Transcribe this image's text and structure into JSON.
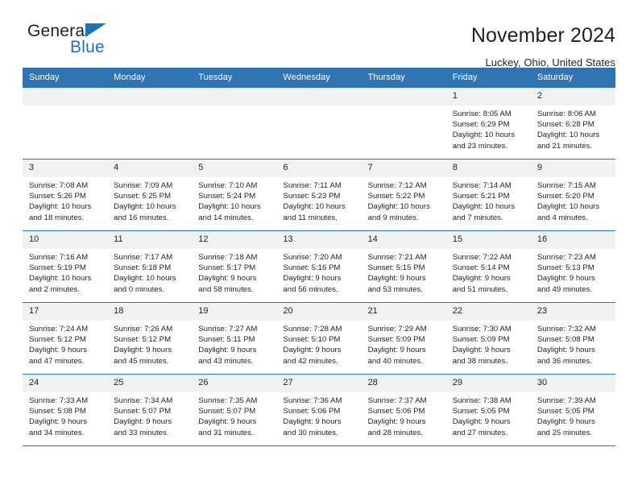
{
  "logo": {
    "word_top": "General",
    "word_bottom": "Blue",
    "triangle_color": "#1b75bc"
  },
  "header": {
    "title": "November 2024",
    "subtitle": "Luckey, Ohio, United States"
  },
  "theme": {
    "header_blue": "#3174b4",
    "daynum_band": "#f1f1f1",
    "text": "#231f20"
  },
  "calendar": {
    "weekday_headers": [
      "Sunday",
      "Monday",
      "Tuesday",
      "Wednesday",
      "Thursday",
      "Friday",
      "Saturday"
    ],
    "weeks": [
      [
        {
          "day": "",
          "empty": true
        },
        {
          "day": "",
          "empty": true
        },
        {
          "day": "",
          "empty": true
        },
        {
          "day": "",
          "empty": true
        },
        {
          "day": "",
          "empty": true
        },
        {
          "day": "1",
          "sunrise": "Sunrise: 8:05 AM",
          "sunset": "Sunset: 6:29 PM",
          "daylight": "Daylight: 10 hours and 23 minutes."
        },
        {
          "day": "2",
          "sunrise": "Sunrise: 8:06 AM",
          "sunset": "Sunset: 6:28 PM",
          "daylight": "Daylight: 10 hours and 21 minutes."
        }
      ],
      [
        {
          "day": "3",
          "sunrise": "Sunrise: 7:08 AM",
          "sunset": "Sunset: 5:26 PM",
          "daylight": "Daylight: 10 hours and 18 minutes."
        },
        {
          "day": "4",
          "sunrise": "Sunrise: 7:09 AM",
          "sunset": "Sunset: 5:25 PM",
          "daylight": "Daylight: 10 hours and 16 minutes."
        },
        {
          "day": "5",
          "sunrise": "Sunrise: 7:10 AM",
          "sunset": "Sunset: 5:24 PM",
          "daylight": "Daylight: 10 hours and 14 minutes."
        },
        {
          "day": "6",
          "sunrise": "Sunrise: 7:11 AM",
          "sunset": "Sunset: 5:23 PM",
          "daylight": "Daylight: 10 hours and 11 minutes."
        },
        {
          "day": "7",
          "sunrise": "Sunrise: 7:12 AM",
          "sunset": "Sunset: 5:22 PM",
          "daylight": "Daylight: 10 hours and 9 minutes."
        },
        {
          "day": "8",
          "sunrise": "Sunrise: 7:14 AM",
          "sunset": "Sunset: 5:21 PM",
          "daylight": "Daylight: 10 hours and 7 minutes."
        },
        {
          "day": "9",
          "sunrise": "Sunrise: 7:15 AM",
          "sunset": "Sunset: 5:20 PM",
          "daylight": "Daylight: 10 hours and 4 minutes."
        }
      ],
      [
        {
          "day": "10",
          "sunrise": "Sunrise: 7:16 AM",
          "sunset": "Sunset: 5:19 PM",
          "daylight": "Daylight: 10 hours and 2 minutes."
        },
        {
          "day": "11",
          "sunrise": "Sunrise: 7:17 AM",
          "sunset": "Sunset: 5:18 PM",
          "daylight": "Daylight: 10 hours and 0 minutes."
        },
        {
          "day": "12",
          "sunrise": "Sunrise: 7:18 AM",
          "sunset": "Sunset: 5:17 PM",
          "daylight": "Daylight: 9 hours and 58 minutes."
        },
        {
          "day": "13",
          "sunrise": "Sunrise: 7:20 AM",
          "sunset": "Sunset: 5:16 PM",
          "daylight": "Daylight: 9 hours and 56 minutes."
        },
        {
          "day": "14",
          "sunrise": "Sunrise: 7:21 AM",
          "sunset": "Sunset: 5:15 PM",
          "daylight": "Daylight: 9 hours and 53 minutes."
        },
        {
          "day": "15",
          "sunrise": "Sunrise: 7:22 AM",
          "sunset": "Sunset: 5:14 PM",
          "daylight": "Daylight: 9 hours and 51 minutes."
        },
        {
          "day": "16",
          "sunrise": "Sunrise: 7:23 AM",
          "sunset": "Sunset: 5:13 PM",
          "daylight": "Daylight: 9 hours and 49 minutes."
        }
      ],
      [
        {
          "day": "17",
          "sunrise": "Sunrise: 7:24 AM",
          "sunset": "Sunset: 5:12 PM",
          "daylight": "Daylight: 9 hours and 47 minutes."
        },
        {
          "day": "18",
          "sunrise": "Sunrise: 7:26 AM",
          "sunset": "Sunset: 5:12 PM",
          "daylight": "Daylight: 9 hours and 45 minutes."
        },
        {
          "day": "19",
          "sunrise": "Sunrise: 7:27 AM",
          "sunset": "Sunset: 5:11 PM",
          "daylight": "Daylight: 9 hours and 43 minutes."
        },
        {
          "day": "20",
          "sunrise": "Sunrise: 7:28 AM",
          "sunset": "Sunset: 5:10 PM",
          "daylight": "Daylight: 9 hours and 42 minutes."
        },
        {
          "day": "21",
          "sunrise": "Sunrise: 7:29 AM",
          "sunset": "Sunset: 5:09 PM",
          "daylight": "Daylight: 9 hours and 40 minutes."
        },
        {
          "day": "22",
          "sunrise": "Sunrise: 7:30 AM",
          "sunset": "Sunset: 5:09 PM",
          "daylight": "Daylight: 9 hours and 38 minutes."
        },
        {
          "day": "23",
          "sunrise": "Sunrise: 7:32 AM",
          "sunset": "Sunset: 5:08 PM",
          "daylight": "Daylight: 9 hours and 36 minutes."
        }
      ],
      [
        {
          "day": "24",
          "sunrise": "Sunrise: 7:33 AM",
          "sunset": "Sunset: 5:08 PM",
          "daylight": "Daylight: 9 hours and 34 minutes."
        },
        {
          "day": "25",
          "sunrise": "Sunrise: 7:34 AM",
          "sunset": "Sunset: 5:07 PM",
          "daylight": "Daylight: 9 hours and 33 minutes."
        },
        {
          "day": "26",
          "sunrise": "Sunrise: 7:35 AM",
          "sunset": "Sunset: 5:07 PM",
          "daylight": "Daylight: 9 hours and 31 minutes."
        },
        {
          "day": "27",
          "sunrise": "Sunrise: 7:36 AM",
          "sunset": "Sunset: 5:06 PM",
          "daylight": "Daylight: 9 hours and 30 minutes."
        },
        {
          "day": "28",
          "sunrise": "Sunrise: 7:37 AM",
          "sunset": "Sunset: 5:06 PM",
          "daylight": "Daylight: 9 hours and 28 minutes."
        },
        {
          "day": "29",
          "sunrise": "Sunrise: 7:38 AM",
          "sunset": "Sunset: 5:05 PM",
          "daylight": "Daylight: 9 hours and 27 minutes."
        },
        {
          "day": "30",
          "sunrise": "Sunrise: 7:39 AM",
          "sunset": "Sunset: 5:05 PM",
          "daylight": "Daylight: 9 hours and 25 minutes."
        }
      ]
    ]
  }
}
